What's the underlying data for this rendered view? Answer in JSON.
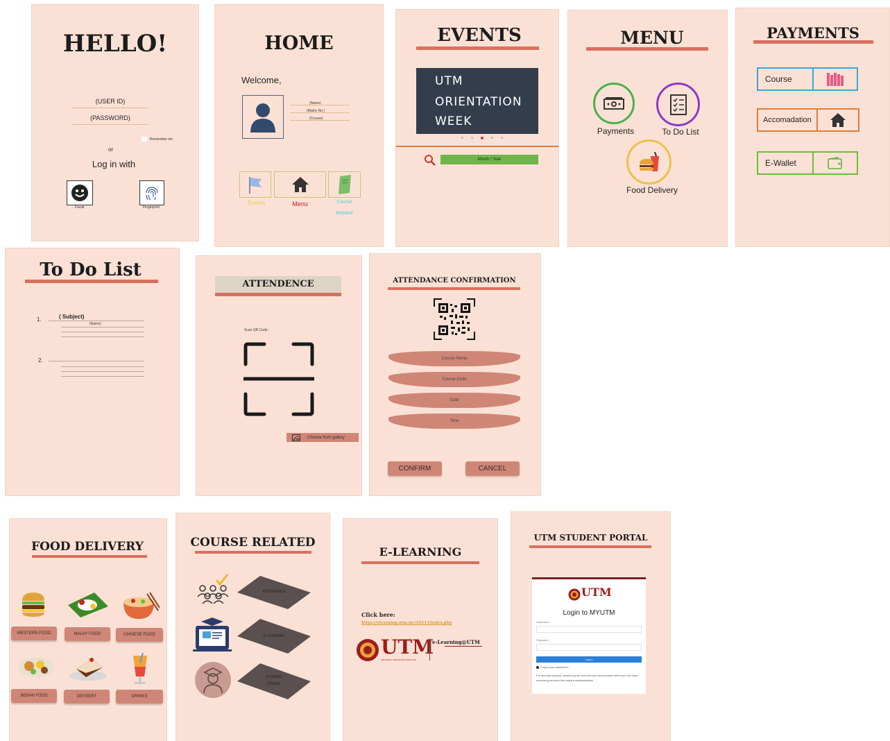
{
  "hello": {
    "title": "HELLO!",
    "user_id": "(USER ID)",
    "password": "(PASSWORD)",
    "remember": "Remember me",
    "or": "or",
    "login_with": "Log in with",
    "facial": "Facial",
    "fingerprint": "Fingerprint"
  },
  "home": {
    "title": "HOME",
    "welcome": "Welcome,",
    "name": "(Name)",
    "matric": "(Matric No.)",
    "course": "(Course)",
    "nav_events": "Events",
    "nav_menu": "Menu",
    "nav_course_1": "Course",
    "nav_course_2": "Related",
    "color_events": "#e9c94f",
    "color_menu": "#b72323",
    "color_course": "#49d0d8"
  },
  "events": {
    "title": "EVENTS",
    "banner_1": "UTM",
    "banner_2": "ORIENTATION",
    "banner_3": "WEEK",
    "month_year": "Month / Year"
  },
  "menu": {
    "title": "MENU",
    "payments": "Payments",
    "todo": "To Do List",
    "food": "Food Delivery"
  },
  "payments": {
    "title": "PAYMENTS",
    "course": "Course",
    "accommodation": "Accomadation",
    "ewallet": "E-Wallet",
    "color_course": "#3aa6d8",
    "color_accom": "#e07c3a",
    "color_wallet": "#6fbb3c"
  },
  "todo": {
    "title": "To Do List",
    "item1_num": "1.",
    "item1_subject": "( Subject)",
    "item1_name": "(Name)",
    "item2_num": "2."
  },
  "attendence": {
    "title": "ATTENDENCE",
    "scan": "Scan QR Code :",
    "gallery": "Choose from gallery"
  },
  "confirm": {
    "title": "ATTENDANCE CONFIRMATION",
    "course_name": "Course Name",
    "course_code": "Course Code",
    "date": "Date",
    "time": "Time",
    "confirm_btn": "CONFIRM",
    "cancel_btn": "CANCEL"
  },
  "food": {
    "title": "FOOD DELIVERY",
    "western": "WESTERN FOOD",
    "malay": "MALAY FOOD",
    "chinese": "CHINESE FOOD",
    "indian": "INDIAN FOOD",
    "dessert": "DESSERT",
    "drinks": "DRINKS"
  },
  "course_related": {
    "title": "COURSE RELATED",
    "attendence": "ATTENDENCE",
    "elearning": "E-LEARNING",
    "portal_1": "STUDENT",
    "portal_2": "PORTAL"
  },
  "elearning": {
    "title": "E-LEARNING",
    "click_here": "Click here:",
    "link": "https://elearning.utm.my/20211/index.php",
    "utm": "UTM",
    "utm_sub": "UNIVERSITI TEKNOLOGI MALAYSIA",
    "elearning_logo": "e-Learning@UTM"
  },
  "portal": {
    "title": "UTM STUDENT PORTAL",
    "utm": "UTM",
    "login_title": "Login to MYUTM",
    "username": "Username",
    "password": "Password",
    "login_btn": "Log in",
    "forgot": "Forgot your password?",
    "security": "For security reasons, please log out and exit your web browser when you are done accessing services that require authentication!"
  }
}
